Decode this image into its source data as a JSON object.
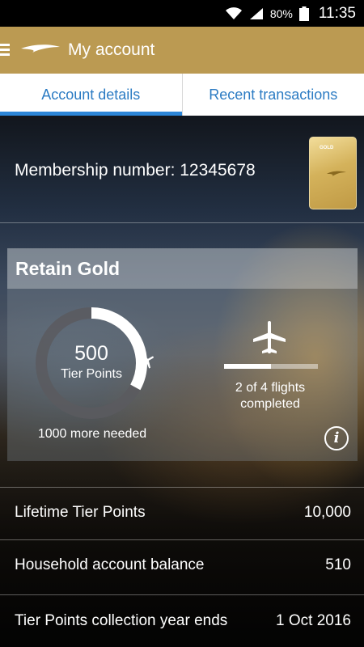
{
  "status_bar": {
    "battery_pct": "80%",
    "time": "11:35"
  },
  "app_bar": {
    "title": "My account"
  },
  "tabs": [
    {
      "label": "Account details",
      "active": true
    },
    {
      "label": "Recent transactions",
      "active": false
    }
  ],
  "membership": {
    "label": "Membership number: 12345678",
    "card_tier": "GOLD"
  },
  "tier_panel": {
    "title": "Retain Gold",
    "tier_points_value": "500",
    "tier_points_label": "Tier Points",
    "needed_text": "1000 more needed",
    "ring_progress": 0.33,
    "flights_text_line1": "2 of 4 flights",
    "flights_text_line2": "completed",
    "flights_progress": 0.5
  },
  "rows": [
    {
      "label": "Lifetime Tier Points",
      "value": "10,000"
    },
    {
      "label": "Household account balance",
      "value": "510"
    },
    {
      "label": "Tier Points collection year ends",
      "value": "1 Oct 2016"
    }
  ],
  "colors": {
    "accent_gold": "#bb9a52",
    "tab_blue": "#2b7bc3",
    "tab_indicator": "#2c86d8"
  }
}
